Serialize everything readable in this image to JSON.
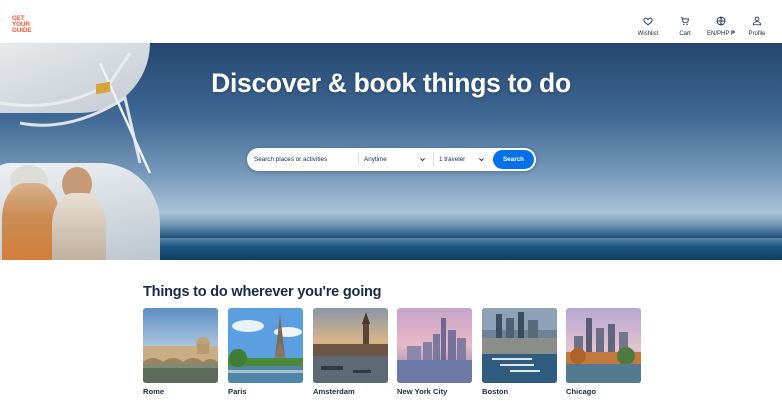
{
  "header": {
    "logo_lines": [
      "GET",
      "YOUR",
      "GUIDE"
    ],
    "nav": [
      {
        "label": "Wishlist",
        "icon": "heart-icon"
      },
      {
        "label": "Cart",
        "icon": "cart-icon"
      },
      {
        "label": "EN/PHP ₱",
        "icon": "globe-icon"
      },
      {
        "label": "Profile",
        "icon": "profile-icon"
      }
    ]
  },
  "hero": {
    "title": "Discover & book things to do"
  },
  "search": {
    "placeholder": "Search places or activities",
    "date_value": "Anytime",
    "travelers_value": "1 traveler",
    "button_label": "Search"
  },
  "destinations": {
    "title": "Things to do wherever you're going",
    "cards": [
      {
        "name": "Rome"
      },
      {
        "name": "Paris"
      },
      {
        "name": "Amsterdam"
      },
      {
        "name": "New York City"
      },
      {
        "name": "Boston"
      },
      {
        "name": "Chicago"
      }
    ]
  },
  "colors": {
    "brand": "#ff5533",
    "accent": "#0071eb",
    "text": "#1a2b49"
  }
}
